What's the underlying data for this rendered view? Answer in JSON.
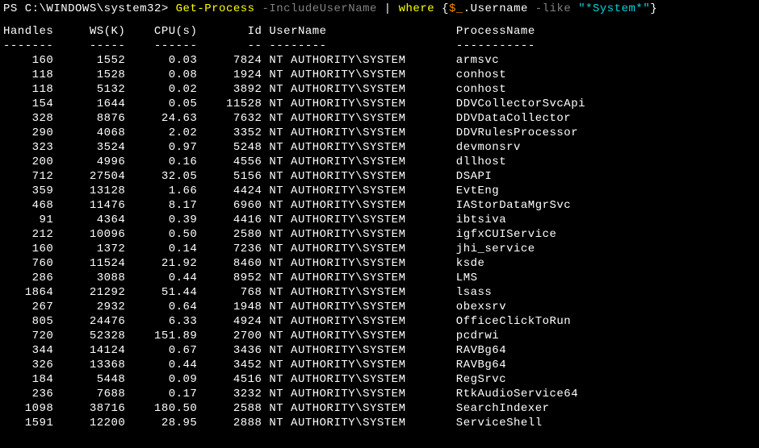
{
  "prompt": {
    "prefix": "PS ",
    "path": "C:\\WINDOWS\\system32>",
    "cmd1": " Get-Process",
    "opt1": " -IncludeUserName",
    "pipe": " | ",
    "cmd2": "where",
    "brace_open": " {",
    "var": "$_",
    "prop": ".Username ",
    "op": "-like ",
    "str": "\"*System*\"",
    "brace_close": "}"
  },
  "headers": {
    "handles": "Handles",
    "ws": "WS(K)",
    "cpu": "CPU(s)",
    "id": "Id",
    "username": "UserName",
    "processname": "ProcessName"
  },
  "separators": {
    "handles": "-------",
    "ws": "-----",
    "cpu": "------",
    "id": "--",
    "username": "--------",
    "processname": "-----------"
  },
  "rows": [
    {
      "handles": "160",
      "ws": "1552",
      "cpu": "0.03",
      "id": "7824",
      "username": "NT AUTHORITY\\SYSTEM",
      "processname": "armsvc"
    },
    {
      "handles": "118",
      "ws": "1528",
      "cpu": "0.08",
      "id": "1924",
      "username": "NT AUTHORITY\\SYSTEM",
      "processname": "conhost"
    },
    {
      "handles": "118",
      "ws": "5132",
      "cpu": "0.02",
      "id": "3892",
      "username": "NT AUTHORITY\\SYSTEM",
      "processname": "conhost"
    },
    {
      "handles": "154",
      "ws": "1644",
      "cpu": "0.05",
      "id": "11528",
      "username": "NT AUTHORITY\\SYSTEM",
      "processname": "DDVCollectorSvcApi"
    },
    {
      "handles": "328",
      "ws": "8876",
      "cpu": "24.63",
      "id": "7632",
      "username": "NT AUTHORITY\\SYSTEM",
      "processname": "DDVDataCollector"
    },
    {
      "handles": "290",
      "ws": "4068",
      "cpu": "2.02",
      "id": "3352",
      "username": "NT AUTHORITY\\SYSTEM",
      "processname": "DDVRulesProcessor"
    },
    {
      "handles": "323",
      "ws": "3524",
      "cpu": "0.97",
      "id": "5248",
      "username": "NT AUTHORITY\\SYSTEM",
      "processname": "devmonsrv"
    },
    {
      "handles": "200",
      "ws": "4996",
      "cpu": "0.16",
      "id": "4556",
      "username": "NT AUTHORITY\\SYSTEM",
      "processname": "dllhost"
    },
    {
      "handles": "712",
      "ws": "27504",
      "cpu": "32.05",
      "id": "5156",
      "username": "NT AUTHORITY\\SYSTEM",
      "processname": "DSAPI"
    },
    {
      "handles": "359",
      "ws": "13128",
      "cpu": "1.66",
      "id": "4424",
      "username": "NT AUTHORITY\\SYSTEM",
      "processname": "EvtEng"
    },
    {
      "handles": "468",
      "ws": "11476",
      "cpu": "8.17",
      "id": "6960",
      "username": "NT AUTHORITY\\SYSTEM",
      "processname": "IAStorDataMgrSvc"
    },
    {
      "handles": "91",
      "ws": "4364",
      "cpu": "0.39",
      "id": "4416",
      "username": "NT AUTHORITY\\SYSTEM",
      "processname": "ibtsiva"
    },
    {
      "handles": "212",
      "ws": "10096",
      "cpu": "0.50",
      "id": "2580",
      "username": "NT AUTHORITY\\SYSTEM",
      "processname": "igfxCUIService"
    },
    {
      "handles": "160",
      "ws": "1372",
      "cpu": "0.14",
      "id": "7236",
      "username": "NT AUTHORITY\\SYSTEM",
      "processname": "jhi_service"
    },
    {
      "handles": "760",
      "ws": "11524",
      "cpu": "21.92",
      "id": "8460",
      "username": "NT AUTHORITY\\SYSTEM",
      "processname": "ksde"
    },
    {
      "handles": "286",
      "ws": "3088",
      "cpu": "0.44",
      "id": "8952",
      "username": "NT AUTHORITY\\SYSTEM",
      "processname": "LMS"
    },
    {
      "handles": "1864",
      "ws": "21292",
      "cpu": "51.44",
      "id": "768",
      "username": "NT AUTHORITY\\SYSTEM",
      "processname": "lsass"
    },
    {
      "handles": "267",
      "ws": "2932",
      "cpu": "0.64",
      "id": "1948",
      "username": "NT AUTHORITY\\SYSTEM",
      "processname": "obexsrv"
    },
    {
      "handles": "805",
      "ws": "24476",
      "cpu": "6.33",
      "id": "4924",
      "username": "NT AUTHORITY\\SYSTEM",
      "processname": "OfficeClickToRun"
    },
    {
      "handles": "720",
      "ws": "52328",
      "cpu": "151.89",
      "id": "2700",
      "username": "NT AUTHORITY\\SYSTEM",
      "processname": "pcdrwi"
    },
    {
      "handles": "344",
      "ws": "14124",
      "cpu": "0.67",
      "id": "3436",
      "username": "NT AUTHORITY\\SYSTEM",
      "processname": "RAVBg64"
    },
    {
      "handles": "326",
      "ws": "13368",
      "cpu": "0.44",
      "id": "3452",
      "username": "NT AUTHORITY\\SYSTEM",
      "processname": "RAVBg64"
    },
    {
      "handles": "184",
      "ws": "5448",
      "cpu": "0.09",
      "id": "4516",
      "username": "NT AUTHORITY\\SYSTEM",
      "processname": "RegSrvc"
    },
    {
      "handles": "236",
      "ws": "7688",
      "cpu": "0.17",
      "id": "3232",
      "username": "NT AUTHORITY\\SYSTEM",
      "processname": "RtkAudioService64"
    },
    {
      "handles": "1098",
      "ws": "38716",
      "cpu": "180.50",
      "id": "2588",
      "username": "NT AUTHORITY\\SYSTEM",
      "processname": "SearchIndexer"
    },
    {
      "handles": "1591",
      "ws": "12200",
      "cpu": "28.95",
      "id": "2888",
      "username": "NT AUTHORITY\\SYSTEM",
      "processname": "ServiceShell"
    }
  ]
}
